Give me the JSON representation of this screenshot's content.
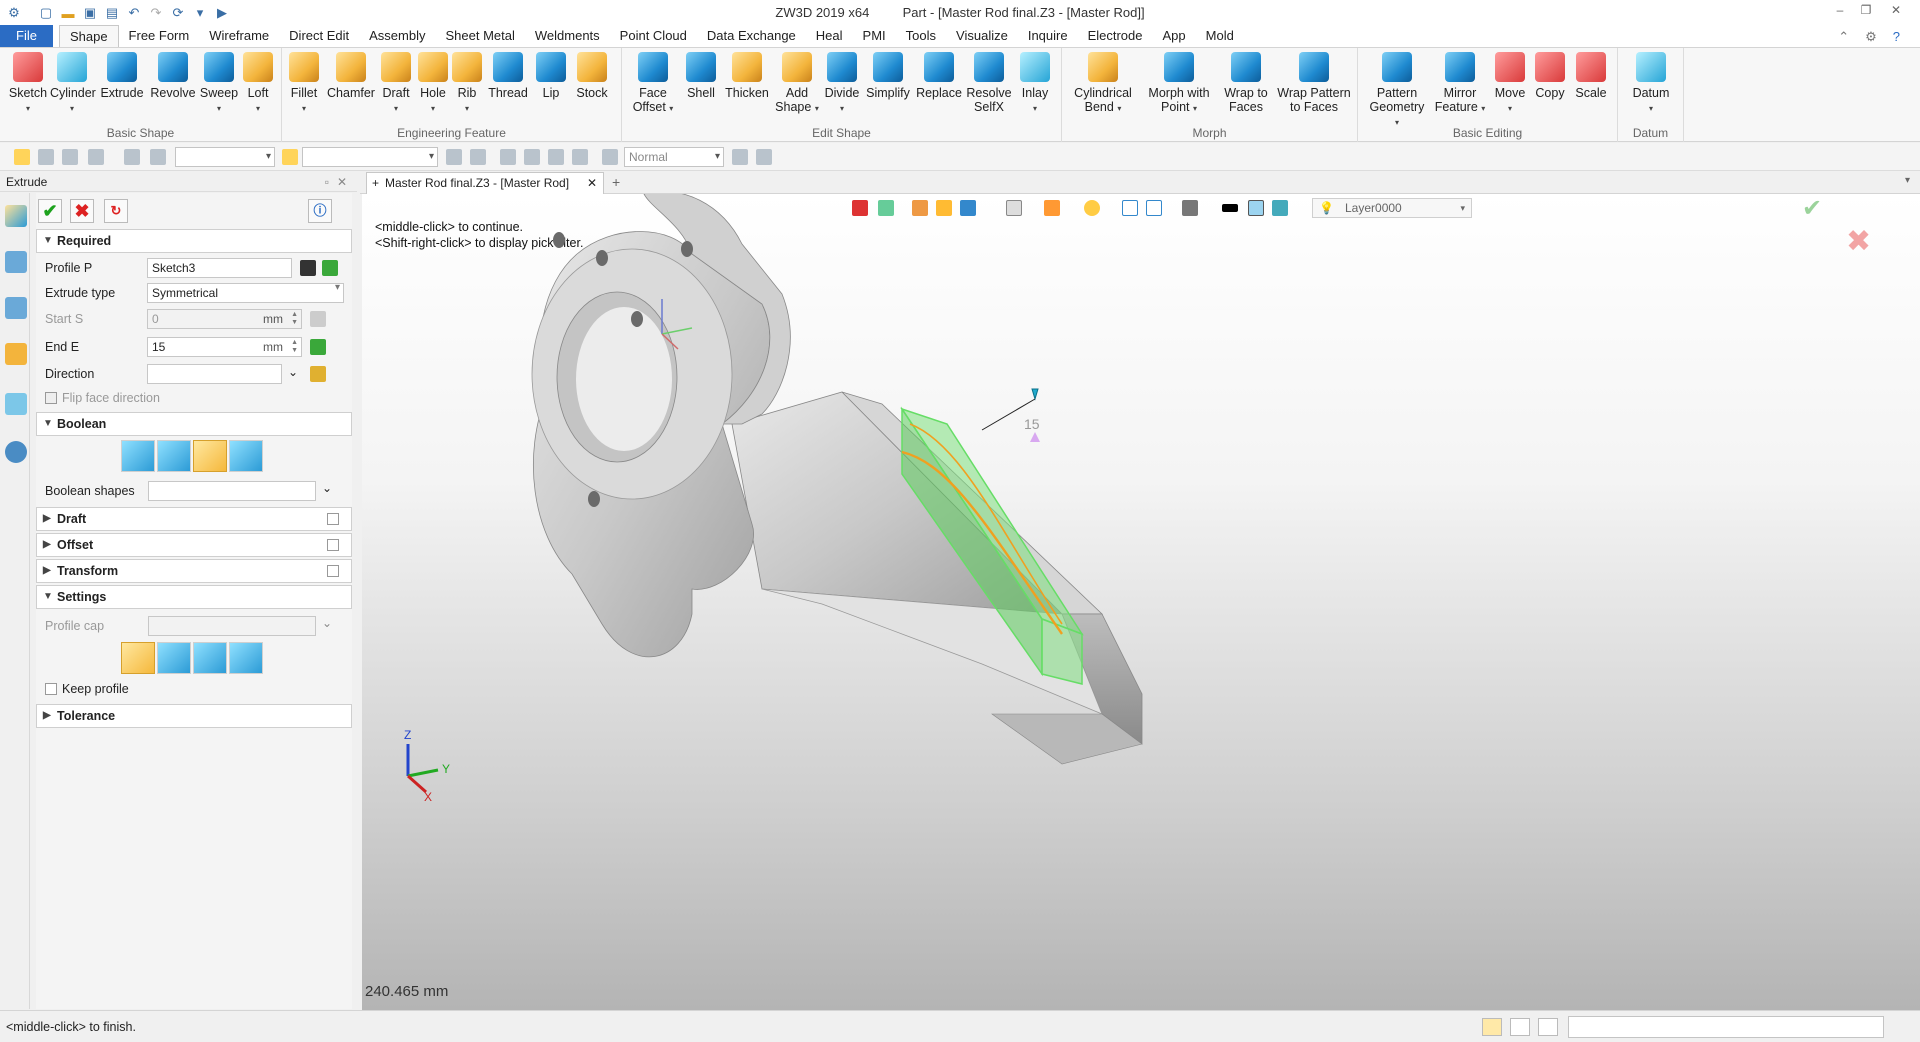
{
  "title_bar": {
    "app_name": "ZW3D 2019  x64",
    "document": "Part - [Master Rod final.Z3 - [Master Rod]]"
  },
  "menu": {
    "tabs": [
      "File",
      "Shape",
      "Free Form",
      "Wireframe",
      "Direct Edit",
      "Assembly",
      "Sheet Metal",
      "Weldments",
      "Point Cloud",
      "Data Exchange",
      "Heal",
      "PMI",
      "Tools",
      "Visualize",
      "Inquire",
      "Electrode",
      "App",
      "Mold"
    ],
    "active": "Shape"
  },
  "ribbon": {
    "groups": [
      {
        "label": "Basic Shape",
        "buttons": [
          "Sketch",
          "Cylinder",
          "Extrude",
          "Revolve",
          "Sweep",
          "Loft"
        ]
      },
      {
        "label": "Engineering Feature",
        "buttons": [
          "Fillet",
          "Chamfer",
          "Draft",
          "Hole",
          "Rib",
          "Thread",
          "Lip",
          "Stock"
        ]
      },
      {
        "label": "Edit Shape",
        "buttons": [
          "Face Offset",
          "Shell",
          "Thicken",
          "Add Shape",
          "Divide",
          "Simplify",
          "Replace",
          "Resolve SelfX",
          "Inlay"
        ]
      },
      {
        "label": "Morph",
        "buttons": [
          "Cylindrical Bend",
          "Morph with Point",
          "Wrap to Faces",
          "Wrap Pattern to Faces"
        ]
      },
      {
        "label": "Basic Editing",
        "buttons": [
          "Pattern Geometry",
          "Mirror Feature",
          "Move",
          "Copy",
          "Scale"
        ]
      },
      {
        "label": "Datum",
        "buttons": [
          "Datum"
        ]
      }
    ]
  },
  "toolbar": {
    "render_mode": "Normal"
  },
  "panel": {
    "title": "Extrude",
    "sections": {
      "required": "Required",
      "boolean": "Boolean",
      "draft": "Draft",
      "offset": "Offset",
      "transform": "Transform",
      "settings": "Settings",
      "tolerance": "Tolerance"
    },
    "fields": {
      "profile_label": "Profile P",
      "profile_value": "Sketch3",
      "extrude_type_label": "Extrude type",
      "extrude_type_value": "Symmetrical",
      "start_label": "Start S",
      "start_value": "0",
      "start_unit": "mm",
      "end_label": "End E",
      "end_value": "15",
      "end_unit": "mm",
      "direction_label": "Direction",
      "direction_value": "",
      "flip_label": "Flip face direction",
      "boolean_shapes_label": "Boolean shapes",
      "profile_cap_label": "Profile cap",
      "keep_profile_label": "Keep profile"
    }
  },
  "document_tab": {
    "label": "Master Rod final.Z3 - [Master Rod]"
  },
  "viewport": {
    "hint_lines": [
      "<middle-click> to continue.",
      "<Shift-right-click> to display pick filter."
    ],
    "layer": "Layer0000",
    "dimension_label": "15",
    "measurement": "240.465 mm",
    "axes": {
      "x": "X",
      "y": "Y",
      "z": "Z"
    }
  },
  "status": {
    "text": "<middle-click> to finish."
  }
}
